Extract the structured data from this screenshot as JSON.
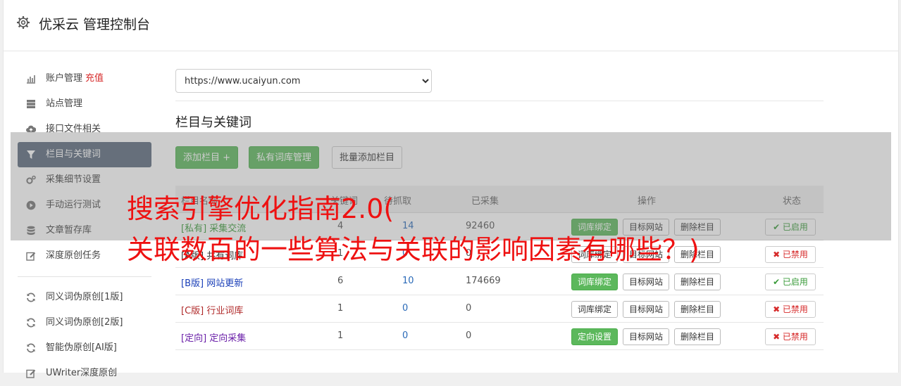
{
  "header": {
    "title": "优采云 管理控制台",
    "icon": "gear-icon"
  },
  "sidebar": {
    "items": [
      {
        "label": "账户管理",
        "extra": "充值",
        "icon": "bar-chart-icon"
      },
      {
        "label": "站点管理",
        "icon": "server-icon"
      },
      {
        "label": "接口文件相关",
        "icon": "cloud-upload-icon"
      },
      {
        "label": "栏目与关键词",
        "icon": "filter-icon",
        "active": true
      },
      {
        "label": "采集细节设置",
        "icon": "cogs-icon"
      },
      {
        "label": "手动运行测试",
        "icon": "play-circle-icon"
      },
      {
        "label": "文章暂存库",
        "icon": "database-icon"
      },
      {
        "label": "深度原创任务",
        "icon": "edit-icon"
      },
      {
        "label": "同义词伪原创[1版]",
        "icon": "refresh-icon"
      },
      {
        "label": "同义词伪原创[2版]",
        "icon": "refresh-icon"
      },
      {
        "label": "智能伪原创[AI版]",
        "icon": "refresh-icon"
      },
      {
        "label": "UWriter深度原创",
        "icon": "edit-icon"
      }
    ]
  },
  "main": {
    "site_select": {
      "value": "https://www.ucaiyun.com"
    },
    "section_title": "栏目与关键词",
    "buttons": {
      "add": "添加栏目 +",
      "private": "私有词库管理",
      "batch": "批量添加栏目"
    },
    "table": {
      "headers": {
        "name": "栏目名称",
        "kw": "关键词",
        "pending": "待抓取",
        "collected": "已采集",
        "ops": "操作",
        "status": "状态"
      },
      "rows": [
        {
          "tag": "[私有]",
          "name": "采集交流",
          "kw": "4",
          "pending": "14",
          "collected": "92460",
          "op1": "词库绑定",
          "op1_style": "g",
          "op2": "目标网站",
          "op3": "删除栏目",
          "status": "✔ 已启用",
          "status_on": true,
          "color": "#3a9b3a"
        },
        {
          "tag": "[A版]",
          "name": "共有词库",
          "kw": "1",
          "pending": "0",
          "collected": "0",
          "op1": "词库绑定",
          "op1_style": "w",
          "op2": "目标网站",
          "op3": "删除栏目",
          "status": "✖ 已禁用",
          "status_on": false,
          "color": "#333333"
        },
        {
          "tag": "[B版]",
          "name": "网站更新",
          "kw": "6",
          "pending": "10",
          "collected": "174669",
          "op1": "词库绑定",
          "op1_style": "g",
          "op2": "目标网站",
          "op3": "删除栏目",
          "status": "✔ 已启用",
          "status_on": true,
          "color": "#1a3fb8"
        },
        {
          "tag": "[C版]",
          "name": "行业词库",
          "kw": "1",
          "pending": "0",
          "collected": "0",
          "op1": "词库绑定",
          "op1_style": "w",
          "op2": "目标网站",
          "op3": "删除栏目",
          "status": "✖ 已禁用",
          "status_on": false,
          "color": "#b02a2a"
        },
        {
          "tag": "[定向]",
          "name": "定向采集",
          "kw": "1",
          "pending": "0",
          "collected": "0",
          "op1": "定向设置",
          "op1_style": "g",
          "op2": "目标网站",
          "op3": "删除栏目",
          "status": "✖ 已禁用",
          "status_on": false,
          "color": "#6a1fa8"
        }
      ]
    }
  },
  "overlay": {
    "line1": "搜索引擎优化指南2.0(",
    "line2": "关联数百的一些算法与关联的影响因素有哪些？)"
  }
}
